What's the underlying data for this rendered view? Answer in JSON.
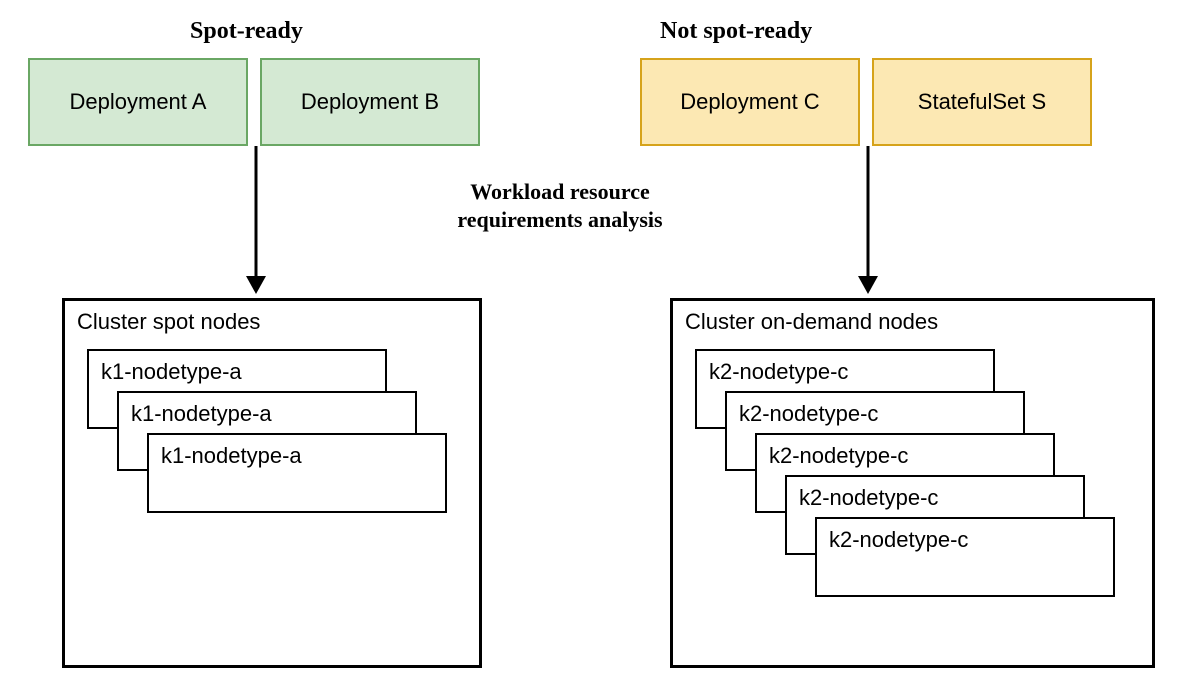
{
  "headings": {
    "spot_ready": "Spot-ready",
    "not_spot_ready": "Not spot-ready"
  },
  "center_label": "Workload resource requirements analysis",
  "deployments": {
    "a": "Deployment A",
    "b": "Deployment B",
    "c": "Deployment C",
    "s": "StatefulSet S"
  },
  "clusters": {
    "spot": {
      "title": "Cluster spot nodes",
      "cards": [
        "k1-nodetype-a",
        "k1-nodetype-a",
        "k1-nodetype-a"
      ]
    },
    "ondemand": {
      "title": "Cluster on-demand nodes",
      "cards": [
        "k2-nodetype-c",
        "k2-nodetype-c",
        "k2-nodetype-c",
        "k2-nodetype-c",
        "k2-nodetype-c"
      ]
    }
  }
}
